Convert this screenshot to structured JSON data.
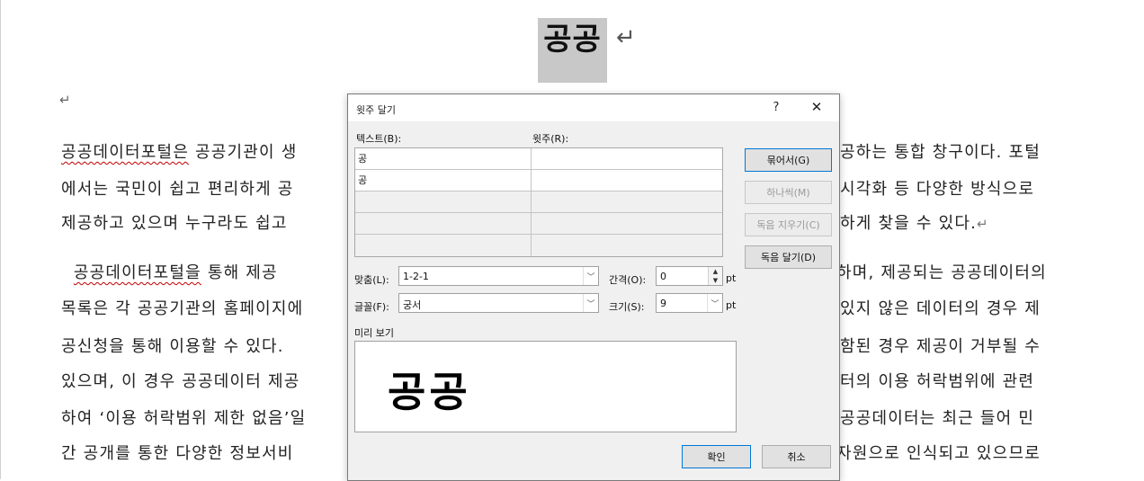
{
  "document": {
    "title": "공공",
    "para_mark": "↵",
    "lines": [
      {
        "left_underlined": "공공데이터포털은",
        "left": " 공공기관이 생",
        "right": "공하는 통합 창구이다. 포털"
      },
      {
        "left": "에서는 국민이 쉽고 편리하게 공",
        "right": "시각화 등 다양한 방식으로"
      },
      {
        "left": "제공하고 있으며 누구라도 쉽고",
        "right": "하게 찾을 수 있다.",
        "right_mark": "↵"
      },
      {
        "left_indent": "  ",
        "left_underlined": "공공데이터포털을",
        "left": " 통해 제공",
        "right": "하며, 제공되는 공공데이터의"
      },
      {
        "left": "목록은 각 공공기관의 홈페이지에",
        "right": "있지 않은 데이터의 경우 제"
      },
      {
        "left": "공신청을 통해 이용할 수 있다.",
        "right": "함된 경우 제공이 거부될 수"
      },
      {
        "left": "있으며, 이 경우 공공데이터 제공",
        "right": "터의 이용 허락범위에 관련"
      },
      {
        "left": "하여 ‘이용 허락범위 제한 없음’일",
        "right": "공공데이터는 최근 들어 민"
      },
      {
        "left": "간 공개를 통한 다양한 정보서비",
        "right": "자원으로 인식되고 있으므로"
      }
    ]
  },
  "dialog": {
    "title": "윗주 달기",
    "help_label": "?",
    "close_label": "✕",
    "text_col_label": "텍스트(B):",
    "ruby_col_label": "윗주(R):",
    "rows": [
      {
        "text": "공",
        "ruby": ""
      },
      {
        "text": "공",
        "ruby": ""
      },
      {
        "text": "",
        "ruby": ""
      },
      {
        "text": "",
        "ruby": ""
      },
      {
        "text": "",
        "ruby": ""
      }
    ],
    "buttons": {
      "group": "묶어서(G)",
      "mono": "하나씩(M)",
      "clear": "독음 지우기(C)",
      "default_reading": "독음 달기(D)"
    },
    "alignment_label": "맞춤(L):",
    "alignment_value": "1-2-1",
    "offset_label": "간격(O):",
    "offset_value": "0",
    "font_label": "글꼴(F):",
    "font_value": "궁서",
    "size_label": "크기(S):",
    "size_value": "9",
    "unit": "pt",
    "preview_label": "미리 보기",
    "preview_text": "공공",
    "ok": "확인",
    "cancel": "취소"
  }
}
